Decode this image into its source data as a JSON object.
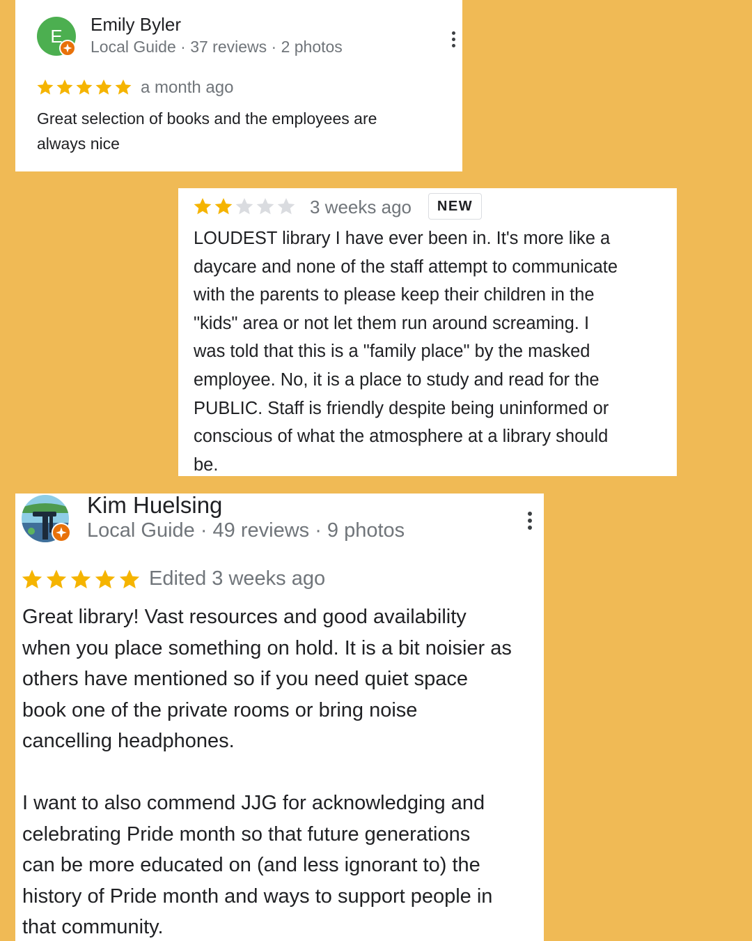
{
  "colors": {
    "background": "#F0BA55",
    "star_filled": "#F5B400",
    "star_empty": "#DADCE0",
    "avatar_emily": "#4CAF50",
    "guide_badge": "#E8710A"
  },
  "reviews": [
    {
      "author": "Emily Byler",
      "avatar_initial": "E",
      "meta": "Local Guide · 37 reviews · 2 photos",
      "rating": 5,
      "time": "a month ago",
      "text": "Great selection of books and the employees are\nalways nice"
    },
    {
      "rating": 2,
      "time": "3 weeks ago",
      "badge": "NEW",
      "text": "LOUDEST library I have ever been in.  It's more like a\ndaycare and none of the staff attempt to communicate\nwith the parents to please keep their children in the\n\"kids\" area or not let them run around screaming.  I\nwas told that this is a \"family place\" by the masked\nemployee.  No, it is a place to study and read for the\nPUBLIC.  Staff is friendly despite being uninformed or\nconscious of what the atmosphere at a library should\nbe."
    },
    {
      "author": "Kim Huelsing",
      "meta": "Local Guide · 49 reviews · 9 photos",
      "rating": 5,
      "time": "Edited 3 weeks ago",
      "text": "Great library! Vast resources and good availability\nwhen you place something on hold. It is a bit noisier as\nothers have mentioned so if you need quiet space\nbook one of the private rooms or bring noise\ncancelling headphones.\n\nI want to also commend JJG for acknowledging and\ncelebrating Pride month so that future generations\ncan be more educated on (and less ignorant to) the\nhistory of Pride month and ways to support people in\nthat community."
    }
  ],
  "icons": {
    "more": "more-vert-icon",
    "star": "star-icon",
    "local_guide": "local-guide-badge-icon"
  }
}
